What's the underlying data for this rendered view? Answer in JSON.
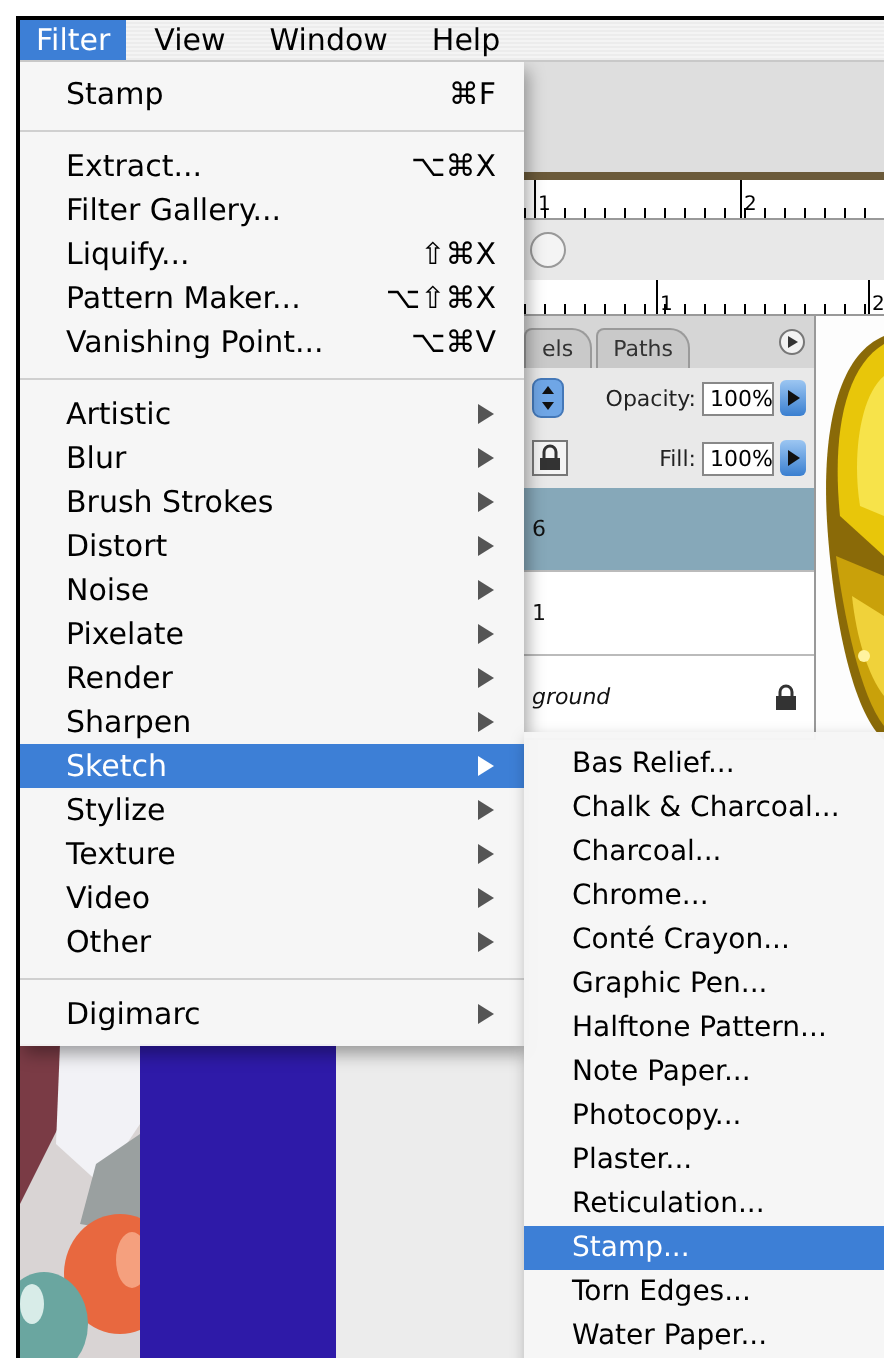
{
  "menubar": [
    {
      "label": "Filter",
      "selected": true
    },
    {
      "label": "View",
      "selected": false
    },
    {
      "label": "Window",
      "selected": false
    },
    {
      "label": "Help",
      "selected": false
    }
  ],
  "filter_menu": [
    {
      "kind": "command",
      "label": "Stamp",
      "shortcut": "⌘F",
      "selected": false
    },
    {
      "kind": "separator"
    },
    {
      "kind": "command",
      "label": "Extract...",
      "shortcut": "⌥⌘X",
      "selected": false
    },
    {
      "kind": "command",
      "label": "Filter Gallery...",
      "selected": false
    },
    {
      "kind": "command",
      "label": "Liquify...",
      "shortcut": "⇧⌘X",
      "selected": false
    },
    {
      "kind": "command",
      "label": "Pattern Maker...",
      "shortcut": "⌥⇧⌘X",
      "selected": false
    },
    {
      "kind": "command",
      "label": "Vanishing Point...",
      "shortcut": "⌥⌘V",
      "selected": false
    },
    {
      "kind": "separator"
    },
    {
      "kind": "submenu",
      "label": "Artistic",
      "selected": false
    },
    {
      "kind": "submenu",
      "label": "Blur",
      "selected": false
    },
    {
      "kind": "submenu",
      "label": "Brush Strokes",
      "selected": false
    },
    {
      "kind": "submenu",
      "label": "Distort",
      "selected": false
    },
    {
      "kind": "submenu",
      "label": "Noise",
      "selected": false
    },
    {
      "kind": "submenu",
      "label": "Pixelate",
      "selected": false
    },
    {
      "kind": "submenu",
      "label": "Render",
      "selected": false
    },
    {
      "kind": "submenu",
      "label": "Sharpen",
      "selected": false
    },
    {
      "kind": "submenu",
      "label": "Sketch",
      "selected": true
    },
    {
      "kind": "submenu",
      "label": "Stylize",
      "selected": false
    },
    {
      "kind": "submenu",
      "label": "Texture",
      "selected": false
    },
    {
      "kind": "submenu",
      "label": "Video",
      "selected": false
    },
    {
      "kind": "submenu",
      "label": "Other",
      "selected": false
    },
    {
      "kind": "separator"
    },
    {
      "kind": "submenu",
      "label": "Digimarc",
      "selected": false
    }
  ],
  "sketch_submenu": [
    {
      "label": "Bas Relief...",
      "selected": false
    },
    {
      "label": "Chalk & Charcoal...",
      "selected": false
    },
    {
      "label": "Charcoal...",
      "selected": false
    },
    {
      "label": "Chrome...",
      "selected": false
    },
    {
      "label": "Conté Crayon...",
      "selected": false
    },
    {
      "label": "Graphic Pen...",
      "selected": false
    },
    {
      "label": "Halftone Pattern...",
      "selected": false
    },
    {
      "label": "Note Paper...",
      "selected": false
    },
    {
      "label": "Photocopy...",
      "selected": false
    },
    {
      "label": "Plaster...",
      "selected": false
    },
    {
      "label": "Reticulation...",
      "selected": false
    },
    {
      "label": "Stamp...",
      "selected": true
    },
    {
      "label": "Torn Edges...",
      "selected": false
    },
    {
      "label": "Water Paper...",
      "selected": false
    }
  ],
  "rulers": [
    {
      "labels": [
        "1",
        "2"
      ]
    },
    {
      "labels": [
        "1",
        "2"
      ]
    }
  ],
  "layers_panel": {
    "tabs": [
      {
        "label": "els",
        "selected": false
      },
      {
        "label": "Paths",
        "selected": false
      }
    ],
    "opacity_label": "Opacity:",
    "opacity": "100%",
    "fill_label": "Fill:",
    "fill": "100%",
    "layers": [
      {
        "name": "6",
        "selected": true,
        "italic": false,
        "locked": false
      },
      {
        "name": "1",
        "selected": false,
        "italic": false,
        "locked": false
      },
      {
        "name": "ground",
        "selected": false,
        "italic": true,
        "locked": true
      }
    ]
  }
}
